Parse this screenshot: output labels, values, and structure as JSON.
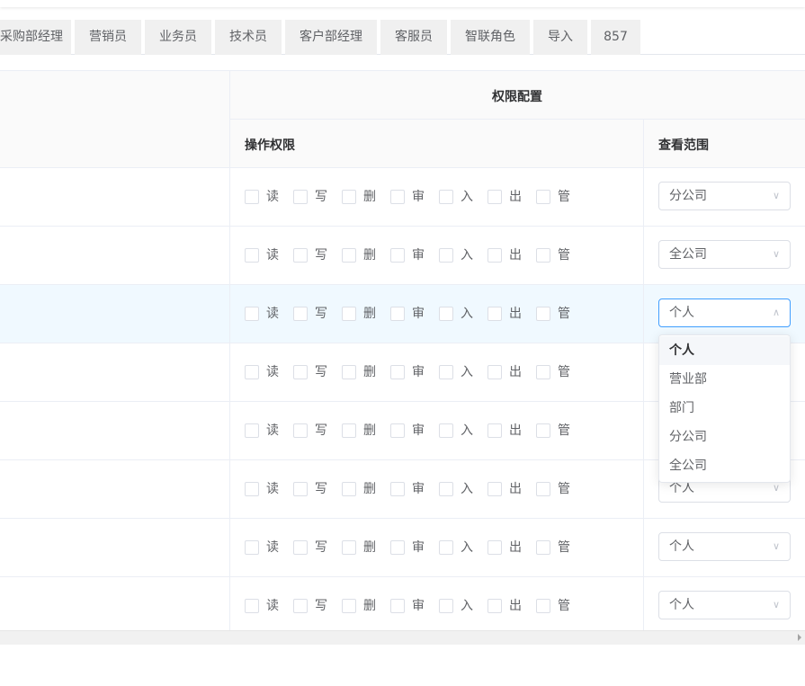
{
  "tabs": [
    {
      "label": "采购部经理"
    },
    {
      "label": "营销员"
    },
    {
      "label": "业务员"
    },
    {
      "label": "技术员"
    },
    {
      "label": "客户部经理"
    },
    {
      "label": "客服员"
    },
    {
      "label": "智联角色"
    },
    {
      "label": "导入"
    },
    {
      "label": "857"
    }
  ],
  "table": {
    "group_header": "权限配置",
    "col_operation": "操作权限",
    "col_scope": "查看范围"
  },
  "permissions": [
    "读",
    "写",
    "删",
    "审",
    "入",
    "出",
    "管"
  ],
  "rows": [
    {
      "scope": "分公司"
    },
    {
      "scope": "全公司"
    },
    {
      "scope": "个人"
    },
    {
      "scope": ""
    },
    {
      "scope": ""
    },
    {
      "scope": "个人"
    },
    {
      "scope": "个人"
    },
    {
      "scope": "个人"
    }
  ],
  "dropdown": {
    "options": [
      "个人",
      "营业部",
      "部门",
      "分公司",
      "全公司"
    ],
    "selected": "个人"
  },
  "icons": {
    "select_arrow": "chevron-down-icon",
    "select_arrow_open": "chevron-up-icon",
    "scroll_right": "triangle-right-icon"
  },
  "colors": {
    "accent": "#409eff",
    "row_highlight": "#f0f9ff",
    "border": "#ebeef5"
  }
}
